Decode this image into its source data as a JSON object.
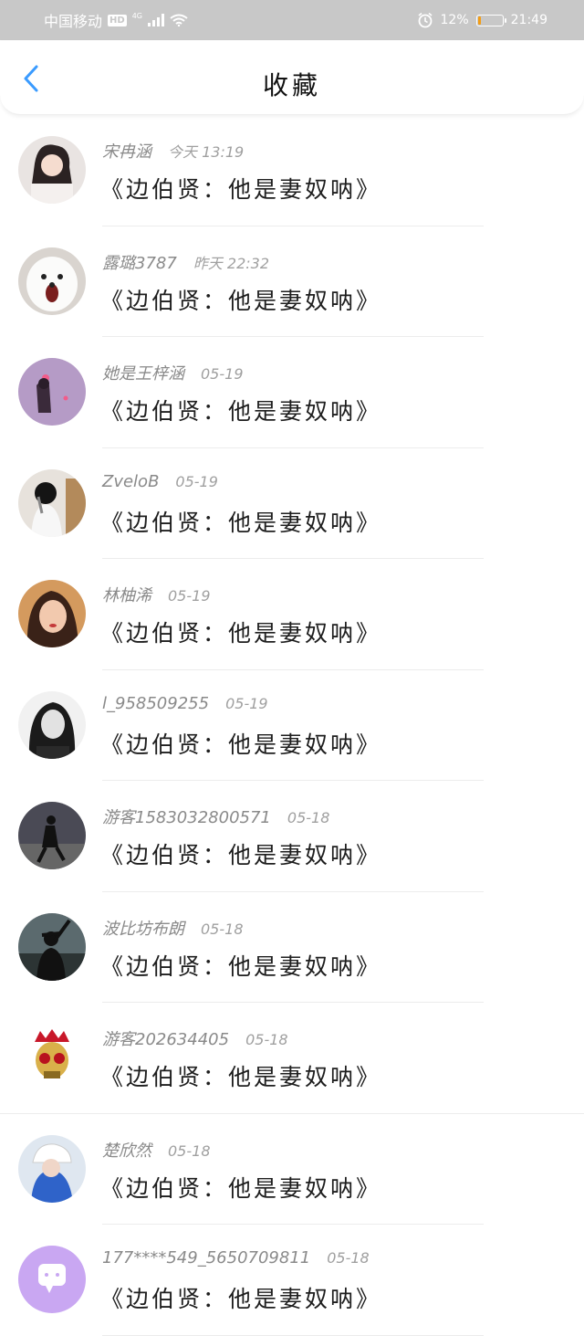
{
  "status_bar": {
    "carrier": "中国移动",
    "hd": "HD",
    "network": "4G",
    "battery_percent": "12%",
    "battery_level": 0.12,
    "time": "21:49"
  },
  "nav": {
    "title": "收藏"
  },
  "colors": {
    "accent": "#3a9bff",
    "status_bar_bg": "#c8c8c8",
    "meta_text": "#8a8a8a",
    "battery_fill": "#f39c12"
  },
  "favorites": [
    {
      "user": "宋冉涵",
      "time": "今天 13:19",
      "text": "《边伯贤：他是妻奴呐》",
      "avatar": "girl-portrait"
    },
    {
      "user": "露璐3787",
      "time": "昨天 22:32",
      "text": "《边伯贤：他是妻奴呐》",
      "avatar": "white-dog"
    },
    {
      "user": "她是王梓涵",
      "time": "05-19",
      "text": "《边伯贤：他是妻奴呐》",
      "avatar": "purple-girl"
    },
    {
      "user": "ZveloB",
      "time": "05-19",
      "text": "《边伯贤：他是妻奴呐》",
      "avatar": "girl-back"
    },
    {
      "user": "林柚浠",
      "time": "05-19",
      "text": "《边伯贤：他是妻奴呐》",
      "avatar": "girl-selfie"
    },
    {
      "user": "l_958509255",
      "time": "05-19",
      "text": "《边伯贤：他是妻奴呐》",
      "avatar": "bw-girl"
    },
    {
      "user": "游客1583032800571",
      "time": "05-18",
      "text": "《边伯贤：他是妻奴呐》",
      "avatar": "dark-dancer"
    },
    {
      "user": "波比坊布朗",
      "time": "05-18",
      "text": "《边伯贤：他是妻奴呐》",
      "avatar": "silhouette"
    },
    {
      "user": "游客202634405",
      "time": "05-18",
      "text": "《边伯贤：他是妻奴呐》",
      "avatar": "skull"
    },
    {
      "user": "楚欣然",
      "time": "05-18",
      "text": "《边伯贤：他是妻奴呐》",
      "avatar": "cap-girl"
    },
    {
      "user": "177****549_5650709811",
      "time": "05-18",
      "text": "《边伯贤：他是妻奴呐》",
      "avatar": "chat-icon"
    }
  ]
}
